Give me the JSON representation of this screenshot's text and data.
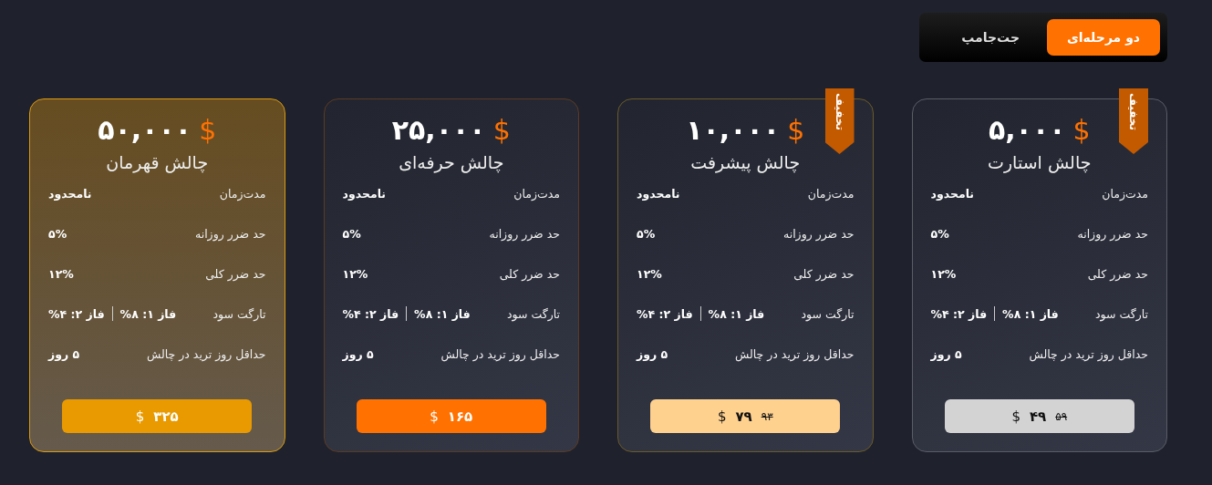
{
  "mode_toggle": [
    {
      "label": "دو مرحله‌ای",
      "selected": true
    },
    {
      "label": "جت‌جامپ",
      "selected": false
    }
  ],
  "cards": [
    {
      "amount": "۵,۰۰۰",
      "currency": "$",
      "title": "چالش استارت",
      "ribbon": "تخفیف",
      "features": [
        {
          "label": "مدت‌زمان",
          "value": "نامحدود"
        },
        {
          "label": "حد ضرر روزانه",
          "value": "۵%"
        },
        {
          "label": "حد ضرر کلی",
          "value": "۱۲%"
        },
        {
          "label": "تارگت سود",
          "phases": [
            "فاز ۱: ۸%",
            "فاز ۲: ۴%"
          ]
        },
        {
          "label": "حداقل روز ترید در چالش",
          "value": "۵ روز"
        }
      ],
      "button": {
        "currency": "$",
        "price": "۴۹",
        "old_price": "۵۹"
      }
    },
    {
      "amount": "۱۰,۰۰۰",
      "currency": "$",
      "title": "چالش پیشرفت",
      "ribbon": "تخفیف",
      "features": [
        {
          "label": "مدت‌زمان",
          "value": "نامحدود"
        },
        {
          "label": "حد ضرر روزانه",
          "value": "۵%"
        },
        {
          "label": "حد ضرر کلی",
          "value": "۱۲%"
        },
        {
          "label": "تارگت سود",
          "phases": [
            "فاز ۱: ۸%",
            "فاز ۲: ۴%"
          ]
        },
        {
          "label": "حداقل روز ترید در چالش",
          "value": "۵ روز"
        }
      ],
      "button": {
        "currency": "$",
        "price": "۷۹",
        "old_price": "۹۳"
      }
    },
    {
      "amount": "۲۵,۰۰۰",
      "currency": "$",
      "title": "چالش حرفه‌ای",
      "features": [
        {
          "label": "مدت‌زمان",
          "value": "نامحدود"
        },
        {
          "label": "حد ضرر روزانه",
          "value": "۵%"
        },
        {
          "label": "حد ضرر کلی",
          "value": "۱۲%"
        },
        {
          "label": "تارگت سود",
          "phases": [
            "فاز ۱: ۸%",
            "فاز ۲: ۴%"
          ]
        },
        {
          "label": "حداقل روز ترید در چالش",
          "value": "۵ روز"
        }
      ],
      "button": {
        "currency": "$",
        "price": "۱۶۵"
      }
    },
    {
      "amount": "۵۰,۰۰۰",
      "currency": "$",
      "title": "چالش قهرمان",
      "features": [
        {
          "label": "مدت‌زمان",
          "value": "نامحدود"
        },
        {
          "label": "حد ضرر روزانه",
          "value": "۵%"
        },
        {
          "label": "حد ضرر کلی",
          "value": "۱۲%"
        },
        {
          "label": "تارگت سود",
          "phases": [
            "فاز ۱: ۸%",
            "فاز ۲: ۴%"
          ]
        },
        {
          "label": "حداقل روز ترید در چالش",
          "value": "۵ روز"
        }
      ],
      "button": {
        "currency": "$",
        "price": "۳۲۵"
      }
    }
  ]
}
